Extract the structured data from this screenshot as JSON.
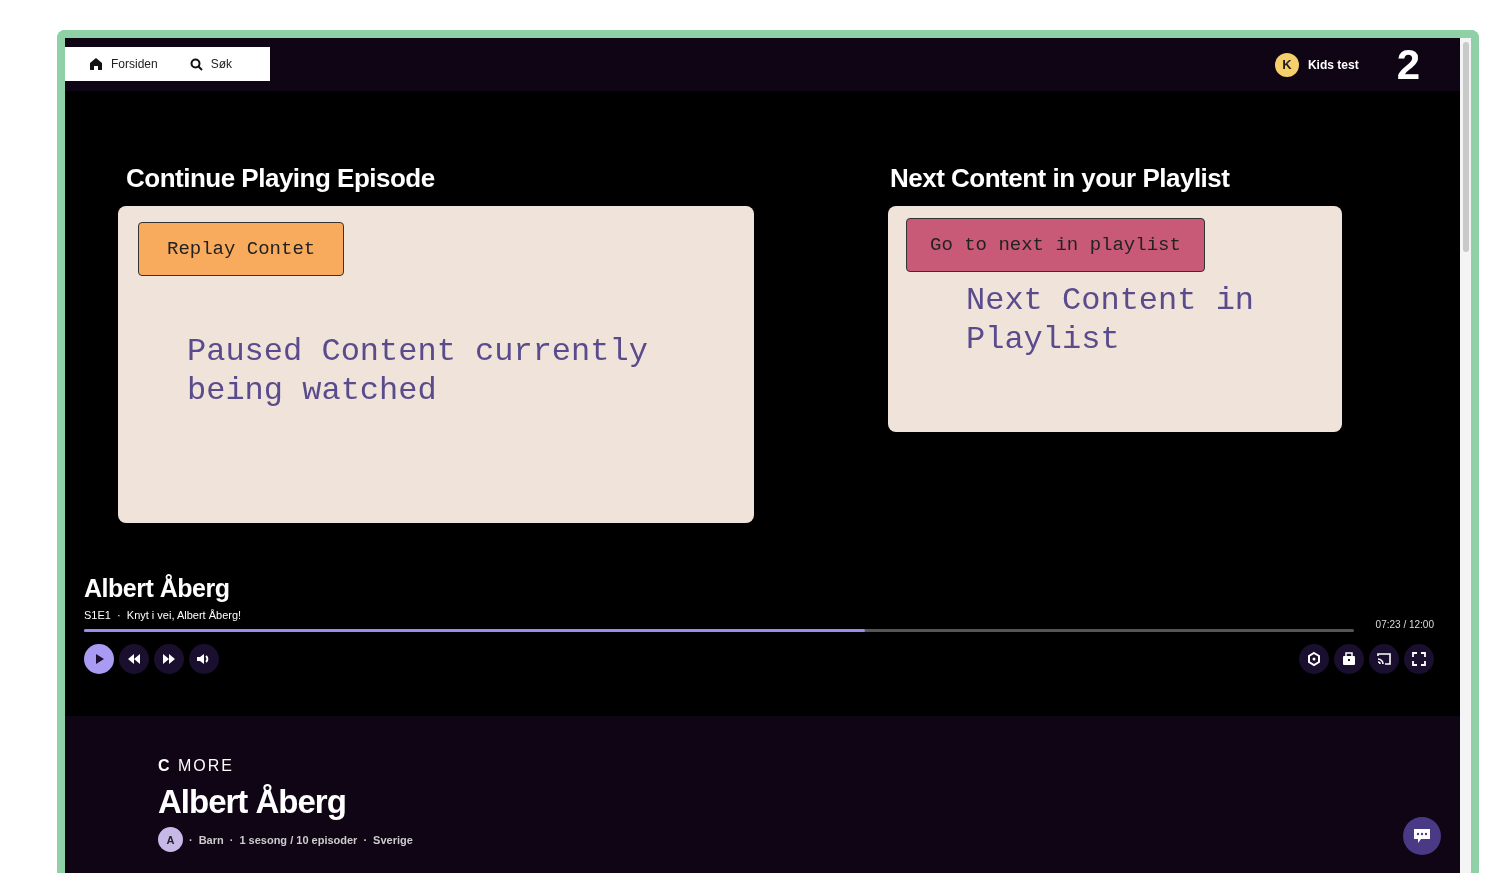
{
  "nav": {
    "items": [
      {
        "label": "Forsiden"
      },
      {
        "label": "Søk"
      }
    ],
    "profile": {
      "initial": "K",
      "name": "Kids test"
    },
    "logo": "2"
  },
  "sections": [
    {
      "title": "Continue Playing Episode",
      "button": {
        "label": "Replay Contet",
        "color": "#f9ab5d"
      },
      "text": "Paused Content currently being watched"
    },
    {
      "title": "Next Content in your Playlist",
      "button": {
        "label": "Go to next in playlist",
        "color": "#c85a78"
      },
      "text": "Next Content in Playlist"
    }
  ],
  "player": {
    "title": "Albert Åberg",
    "subtitle": "S1E1  ·  Knyt i vei, Albert Åberg!",
    "progress": {
      "level": 0.615
    },
    "time": "07:23 / 12:00"
  },
  "show": {
    "brand": "**C** MORE",
    "title": "Albert Åberg",
    "rating": "A",
    "separator": "·",
    "meta": [
      "Barn",
      "1 sesong / 10 episoder",
      "Sverige"
    ]
  }
}
